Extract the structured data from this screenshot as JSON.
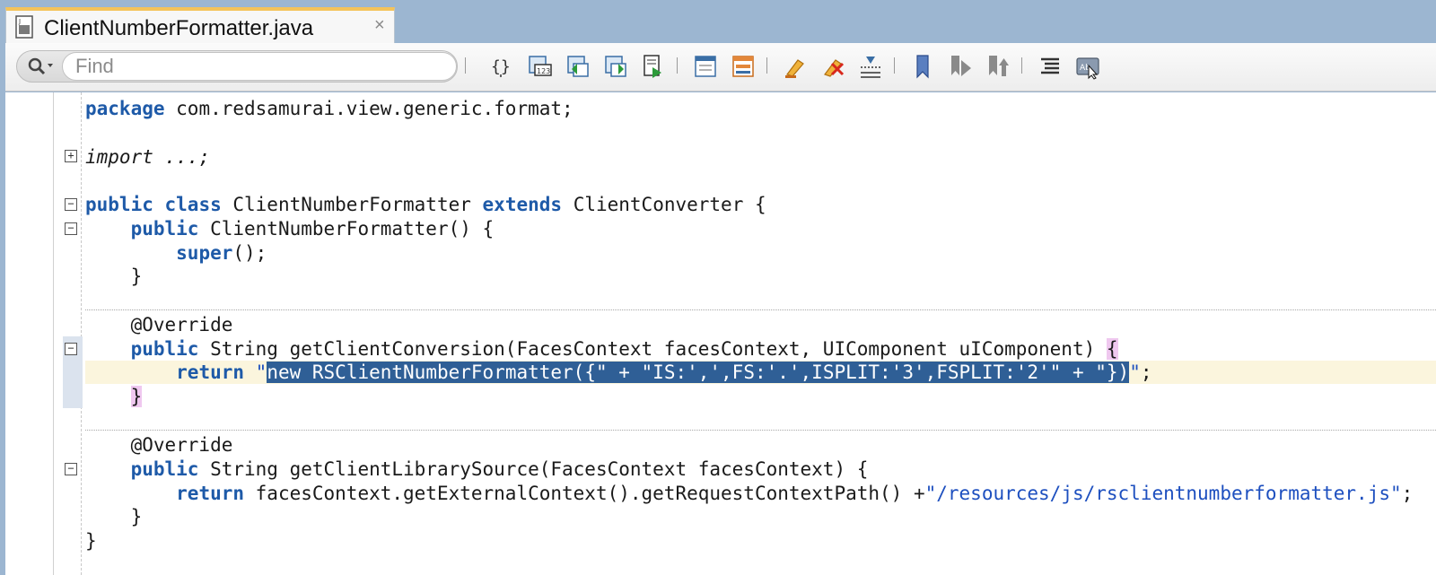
{
  "tab": {
    "title": "ClientNumberFormatter.java",
    "close": "×",
    "icon": "java-file-icon"
  },
  "toolbar": {
    "search_placeholder": "Find",
    "buttons": [
      "select-block-icon",
      "find-usages-icon",
      "previous-occurrence-icon",
      "next-occurrence-icon",
      "goto-line-icon",
      "toggle-panel-icon",
      "split-panel-icon",
      "highlight-icon",
      "clear-highlight-icon",
      "goto-source-icon",
      "bookmark-icon",
      "next-bookmark-icon",
      "previous-bookmark-icon",
      "outline-icon",
      "shortcut-icon"
    ]
  },
  "code": {
    "l1_kw": "package",
    "l1_rest": " com.redsamurai.view.generic.format;",
    "l2_kw": "import",
    "l2_rest": " ...;",
    "l3_kw1": "public",
    "l3_kw2": "class",
    "l3_mid": " ClientNumberFormatter ",
    "l3_kw3": "extends",
    "l3_rest": " ClientConverter {",
    "l4_kw": "public",
    "l4_rest": " ClientNumberFormatter() {",
    "l5_kw": "super",
    "l5_rest": "();",
    "l6": "}",
    "l7": "@Override",
    "l8_kw": "public",
    "l8_rest": " String getClientConversion(FacesContext facesContext, UIComponent uIComponent) ",
    "l8_brace": "{",
    "l9_kw": "return",
    "l9_q1": " \"",
    "l9_sel": "new RSClientNumberFormatter({\" + \"IS:',',FS:'.',ISPLIT:'3',FSPLIT:'2'\" + \"})",
    "l9_q2": "\"",
    "l9_end": ";",
    "l10_brace": "}",
    "l11": "@Override",
    "l12_kw": "public",
    "l12_rest": " String getClientLibrarySource(FacesContext facesContext) {",
    "l13_kw": "return",
    "l13_mid": " facesContext.getExternalContext().getRequestContextPath() +",
    "l13_str": "\"/resources/js/rsclientnumberformatter.js\"",
    "l13_end": ";",
    "l14": "}",
    "l15": "}"
  },
  "folds": {
    "expand": "+",
    "collapse": "−"
  },
  "colors": {
    "keyword": "#1e5aa8",
    "string": "#1d4fbf",
    "selection": "#2f5f96",
    "brace_match": "#efc8ef",
    "current_line": "#fbf5dd"
  }
}
